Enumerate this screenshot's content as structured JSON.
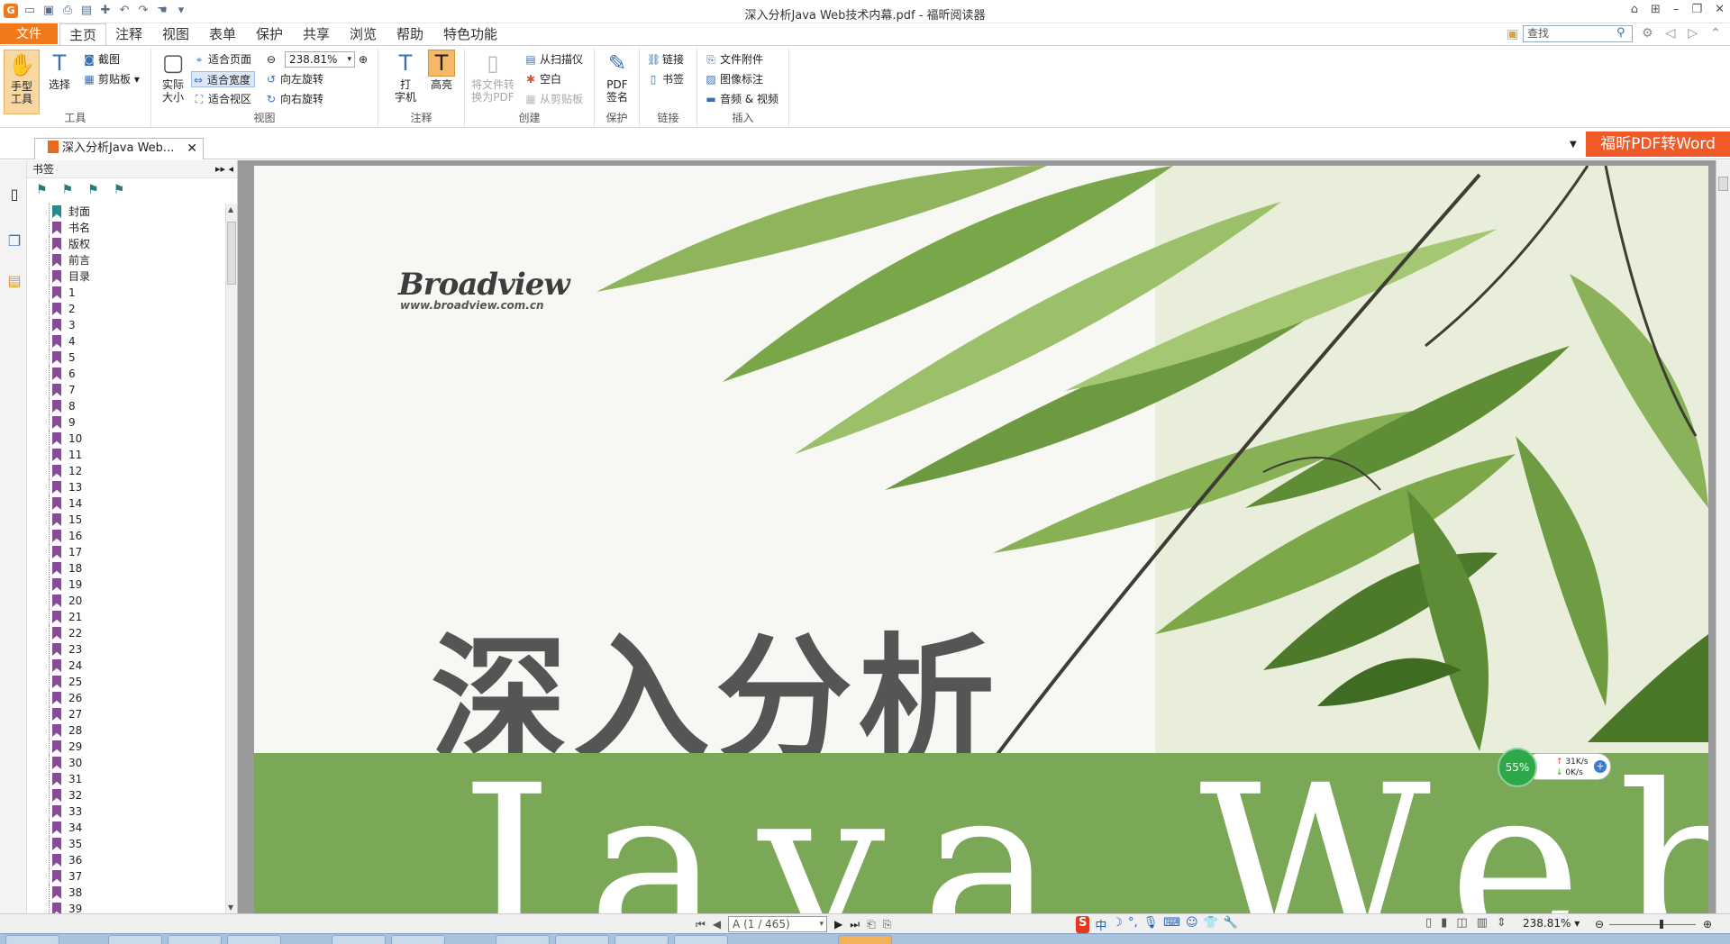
{
  "window": {
    "title": "深入分析Java Web技术内幕.pdf - 福昕阅读器"
  },
  "menu": {
    "file": "文件",
    "tabs": [
      "主页",
      "注释",
      "视图",
      "表单",
      "保护",
      "共享",
      "浏览",
      "帮助",
      "特色功能"
    ],
    "search_placeholder": "查找"
  },
  "ribbon": {
    "tools": {
      "hand": "手型\n工具",
      "select": "选择",
      "screenshot": "截图",
      "clipboard": "剪贴板",
      "label": "工具"
    },
    "view": {
      "actual_size": "实际\n大小",
      "fit_page": "适合页面",
      "fit_width": "适合宽度",
      "fit_visible": "适合视区",
      "zoom": "238.81%",
      "rotate_left": "向左旋转",
      "rotate_right": "向右旋转",
      "label": "视图"
    },
    "annotate": {
      "typewriter": "打\n字机",
      "highlight": "高亮",
      "label": "注释"
    },
    "create": {
      "convert": "将文件转\n换为PDF",
      "from_scanner": "从扫描仪",
      "blank": "空白",
      "from_clipboard": "从剪贴板",
      "label": "创建"
    },
    "protect": {
      "sign": "PDF\n签名",
      "label": "保护"
    },
    "links": {
      "link": "链接",
      "bookmark": "书签",
      "label": "链接"
    },
    "insert": {
      "attachment": "文件附件",
      "image": "图像标注",
      "media": "音频 & 视频",
      "label": "插入"
    }
  },
  "doc_tab": {
    "label": "深入分析Java Web..."
  },
  "promo": "福昕PDF转Word",
  "bookmarks": {
    "title": "书签",
    "items": [
      "封面",
      "书名",
      "版权",
      "前言",
      "目录",
      "1",
      "2",
      "3",
      "4",
      "5",
      "6",
      "7",
      "8",
      "9",
      "10",
      "11",
      "12",
      "13",
      "14",
      "15",
      "16",
      "17",
      "18",
      "19",
      "20",
      "21",
      "22",
      "23",
      "24",
      "25",
      "26",
      "27",
      "28",
      "29",
      "30",
      "31",
      "32",
      "33",
      "34",
      "35",
      "36",
      "37",
      "38",
      "39"
    ]
  },
  "page": {
    "brand": "Broadview",
    "brand_url": "www.broadview.com.cn",
    "title_cn": "深入分析",
    "title_en": "Java Web"
  },
  "net_widget": {
    "percent": "55%",
    "up": "31K/s",
    "down": "0K/s"
  },
  "status": {
    "page_indicator": "A (1 / 465)",
    "ime": "中",
    "zoom": "238.81%"
  },
  "colors": {
    "accent": "#f07a1b",
    "promo": "#f05a28",
    "band": "#7aa856"
  }
}
